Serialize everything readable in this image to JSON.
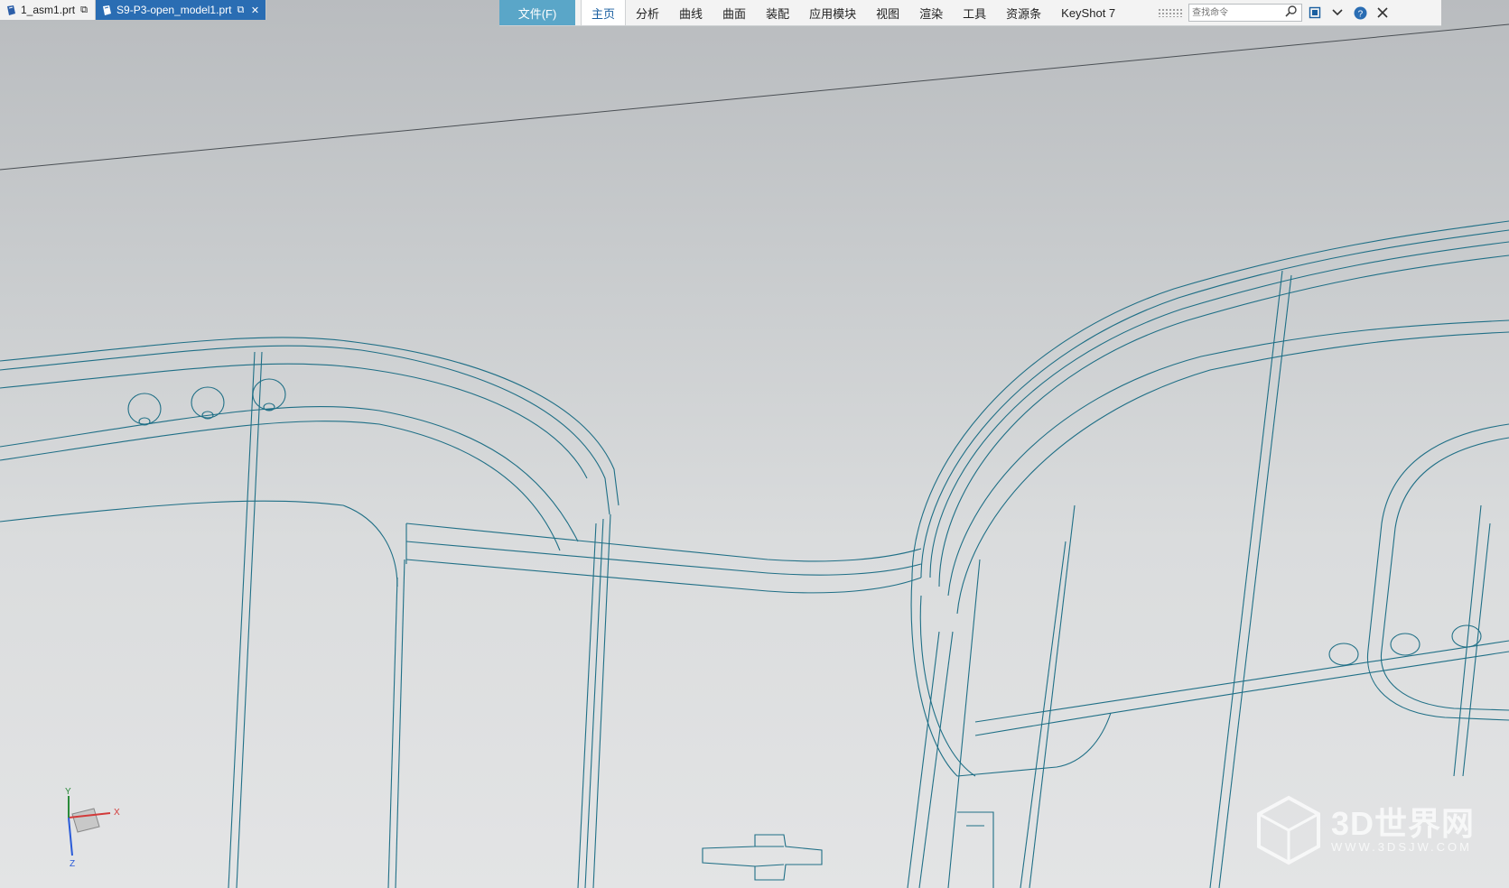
{
  "tabs": [
    {
      "label": "1_asm1.prt",
      "active": false
    },
    {
      "label": "S9-P3-open_model1.prt",
      "active": true
    }
  ],
  "ribbon": {
    "file_label": "文件(F)",
    "items": [
      "主页",
      "分析",
      "曲线",
      "曲面",
      "装配",
      "应用模块",
      "视图",
      "渲染",
      "工具",
      "资源条",
      "KeyShot 7"
    ],
    "active_item": "主页",
    "search_placeholder": "查找命令"
  },
  "triad": {
    "x": "X",
    "y": "Y",
    "z": "Z"
  },
  "watermark": {
    "title": "3D世界网",
    "url": "WWW.3DSJW.COM"
  },
  "colors": {
    "wire": "#1f6f86",
    "accent": "#5aa6c8",
    "active_tab": "#2a6db3"
  }
}
